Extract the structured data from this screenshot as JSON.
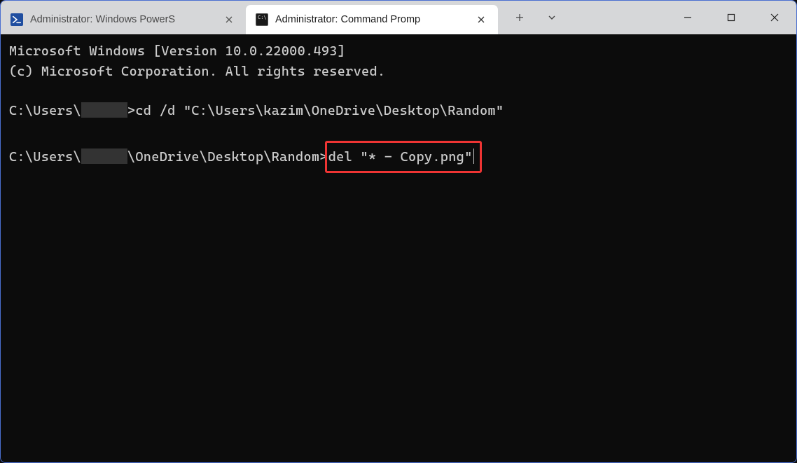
{
  "titlebar": {
    "tabs": [
      {
        "icon": "powershell-icon",
        "title": "Administrator: Windows PowerS",
        "active": false
      },
      {
        "icon": "cmd-icon",
        "title": "Administrator: Command Promp",
        "active": true
      }
    ],
    "new_tab_label": "+",
    "dropdown_label": "⌄"
  },
  "window_controls": {
    "minimize": "minimize",
    "maximize": "maximize",
    "close": "close"
  },
  "terminal": {
    "line1": "Microsoft Windows [Version 10.0.22000.493]",
    "line2": "(c) Microsoft Corporation. All rights reserved.",
    "prompt1_prefix": "C:\\Users\\",
    "prompt1_suffix": ">",
    "command1": "cd /d \"C:\\Users\\kazim\\OneDrive\\Desktop\\Random\"",
    "prompt2_prefix": "C:\\Users\\",
    "prompt2_path": "\\OneDrive\\Desktop\\Random>",
    "command2": "del \"* - Copy.png\"",
    "redacted_label": "[redacted]"
  },
  "highlight": {
    "color": "#ee3433",
    "target": "command2"
  }
}
